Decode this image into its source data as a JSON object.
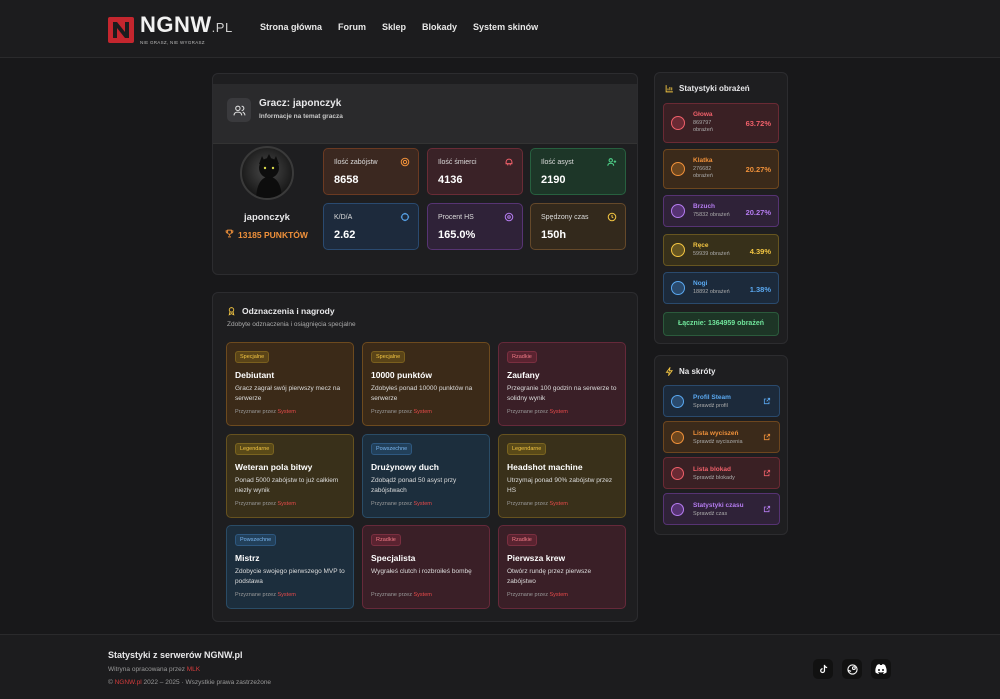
{
  "header": {
    "brand": "NGNW",
    "brand_suffix": ".PL",
    "tagline": "NIE GRASZ, NIE WYGRASZ",
    "nav": [
      "Strona główna",
      "Forum",
      "Sklep",
      "Blokady",
      "System skinów"
    ]
  },
  "player": {
    "title": "Gracz: japonczyk",
    "subtitle": "Informacje na temat gracza",
    "name": "japonczyk",
    "points": "13185 PUNKTÓW",
    "stats": [
      {
        "label": "Ilość zabójstw",
        "value": "8658"
      },
      {
        "label": "Ilość śmierci",
        "value": "4136"
      },
      {
        "label": "Ilość asyst",
        "value": "2190"
      },
      {
        "label": "K/D/A",
        "value": "2.62"
      },
      {
        "label": "Procent HS",
        "value": "165.0%"
      },
      {
        "label": "Spędzony czas",
        "value": "150h"
      }
    ]
  },
  "badges": {
    "title": "Odznaczenia i nagrody",
    "subtitle": "Zdobyte odznaczenia i osiągnięcia specjalne",
    "by_prefix": "Przyznane przez",
    "by_name": "System",
    "items": [
      {
        "tag": "Specjalne",
        "title": "Debiutant",
        "desc": "Gracz zagrał swój pierwszy mecz na serwerze"
      },
      {
        "tag": "Specjalne",
        "title": "10000 punktów",
        "desc": "Zdobyłeś ponad 10000 punktów na serwerze"
      },
      {
        "tag": "Rzadkie",
        "title": "Zaufany",
        "desc": "Przegranie 100 godzin na serwerze to solidny wynik"
      },
      {
        "tag": "Legendarne",
        "title": "Weteran pola bitwy",
        "desc": "Ponad 5000 zabójstw to już całkiem niezły wynik"
      },
      {
        "tag": "Powszechne",
        "title": "Drużynowy duch",
        "desc": "Zdobądź ponad 50 asyst przy zabójstwach"
      },
      {
        "tag": "Legendarne",
        "title": "Headshot machine",
        "desc": "Utrzymaj ponad 90% zabójstw przez HS"
      },
      {
        "tag": "Powszechne",
        "title": "Mistrz",
        "desc": "Zdobycie swojego pierwszego MVP to podstawa"
      },
      {
        "tag": "Rzadkie",
        "title": "Specjalista",
        "desc": "Wygrałeś clutch i rozbroiłeś bombę"
      },
      {
        "tag": "Rzadkie",
        "title": "Pierwsza krew",
        "desc": "Otwórz rundę przez pierwsze zabójstwo"
      }
    ]
  },
  "damage": {
    "title": "Statystyki obrażeń",
    "items": [
      {
        "name": "Głowa",
        "count": "869797",
        "unit": "obrażeń",
        "pct": "63.72%",
        "color": "#f0606a"
      },
      {
        "name": "Klatka",
        "count": "276682",
        "unit": "obrażeń",
        "pct": "20.27%",
        "color": "#f0913a"
      },
      {
        "name": "Brzuch",
        "count": "75832",
        "unit": "obrażeń",
        "pct": "20.27%",
        "color": "#b57cf0"
      },
      {
        "name": "Ręce",
        "count": "59939",
        "unit": "obrażeń",
        "pct": "4.39%",
        "color": "#f3c542"
      },
      {
        "name": "Nogi",
        "count": "18892",
        "unit": "obrażeń",
        "pct": "1.38%",
        "color": "#5aa8f0"
      }
    ],
    "total": "Łącznie: 1364959 obrażeń"
  },
  "shortcuts": {
    "title": "Na skróty",
    "items": [
      {
        "title": "Profil Steam",
        "sub": "Sprawdź profil",
        "color": "#5aa8f0"
      },
      {
        "title": "Lista wyciszeń",
        "sub": "Sprawdź wyciszenia",
        "color": "#f0913a"
      },
      {
        "title": "Lista blokad",
        "sub": "Sprawdź blokady",
        "color": "#f0606a"
      },
      {
        "title": "Statystyki czasu",
        "sub": "Sprawdź czas",
        "color": "#b57cf0"
      }
    ]
  },
  "footer": {
    "title": "Statystyki z serwerów NGNW.pl",
    "made_by_prefix": "Witryna opracowana przez",
    "made_by": "MLK",
    "copyright_site": "NGNW.pl",
    "copyright_rest": "2022 – 2025 · Wszystkie prawa zastrzeżone"
  }
}
